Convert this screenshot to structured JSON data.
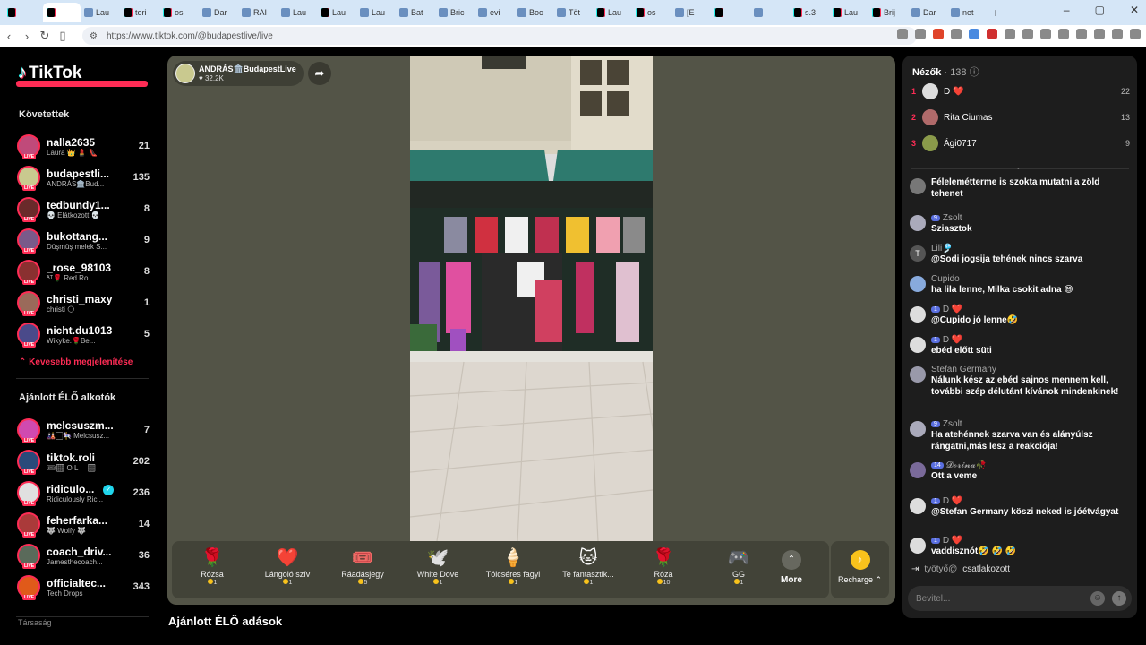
{
  "browser": {
    "tabs": [
      {
        "label": "",
        "icon": "tiktok"
      },
      {
        "label": "",
        "icon": "tiktok"
      },
      {
        "label": "Lau",
        "icon": "doc"
      },
      {
        "label": "tori",
        "icon": "tiktok"
      },
      {
        "label": "os",
        "icon": "tiktok"
      },
      {
        "label": "Dar",
        "icon": "doc"
      },
      {
        "label": "RAI",
        "icon": "doc"
      },
      {
        "label": "Lau",
        "icon": "doc"
      },
      {
        "label": "Lau",
        "icon": "tiktok"
      },
      {
        "label": "Lau",
        "icon": "doc"
      },
      {
        "label": "Bat",
        "icon": "doc"
      },
      {
        "label": "Bric",
        "icon": "doc"
      },
      {
        "label": "evi",
        "icon": "doc"
      },
      {
        "label": "Boc",
        "icon": "doc"
      },
      {
        "label": "Töt",
        "icon": "doc"
      },
      {
        "label": "Lau",
        "icon": "tiktok"
      },
      {
        "label": "os",
        "icon": "tiktok"
      },
      {
        "label": "[E",
        "icon": "doc"
      },
      {
        "label": "",
        "icon": "tiktok"
      },
      {
        "label": "",
        "icon": "doc"
      },
      {
        "label": "s.3",
        "icon": "tiktok"
      },
      {
        "label": "Lau",
        "icon": "tiktok"
      },
      {
        "label": "Brij",
        "icon": "tiktok"
      },
      {
        "label": "Dar",
        "icon": "doc"
      },
      {
        "label": "net",
        "icon": "doc"
      }
    ],
    "url": "https://www.tiktok.com/@budapestlive/live"
  },
  "sidebar": {
    "brand": "TikTok",
    "following_title": "Követettek",
    "following": [
      {
        "name": "nalla2635",
        "sub": "Laura 👑 💄 👠",
        "count": "21",
        "color": "#c04a7a"
      },
      {
        "name": "budapestli...",
        "sub": "ANDRÁS🏛️Bud...",
        "count": "135",
        "color": "#c9c98f"
      },
      {
        "name": "tedbundy1...",
        "sub": "💀 Elátkozott 💀",
        "count": "8",
        "color": "#6a2a2a"
      },
      {
        "name": "bukottang...",
        "sub": "Düşmüş melek S...",
        "count": "9",
        "color": "#7a5a8a"
      },
      {
        "name": "_rose_98103",
        "sub": "ᴬᵀ🌹 Red Ro...",
        "count": "8",
        "color": "#8a3030"
      },
      {
        "name": "christi_maxy",
        "sub": "christi 🌕",
        "count": "1",
        "color": "#9a6a5a"
      },
      {
        "name": "nicht.du1013",
        "sub": "Wikyke.🌹Be...",
        "count": "5",
        "color": "#4a4a8a"
      }
    ],
    "show_less": "Kevesebb megjelenítése",
    "recommended_title": "Ajánlott ÉLŐ alkotók",
    "recommended": [
      {
        "name": "melcsuszm...",
        "sub": "🎎🏻🎠 Melcsusz...",
        "count": "7",
        "color": "#d04ab0"
      },
      {
        "name": "tiktok.roli",
        "sub": "🎟🏻 O L 🏻",
        "count": "202",
        "color": "#2a4a7a"
      },
      {
        "name": "ridiculo...",
        "sub": "Ridiculously Ric...",
        "count": "236",
        "color": "#e0e0e0",
        "verified": true
      },
      {
        "name": "feherfarka...",
        "sub": "🐺 Wolfy 🐺",
        "count": "14",
        "color": "#aa3a3a"
      },
      {
        "name": "coach_driv...",
        "sub": "Jamesthecoach...",
        "count": "36",
        "color": "#5a6a5a"
      },
      {
        "name": "officialtec...",
        "sub": "Tech Drops",
        "count": "343",
        "color": "#e05a1a"
      }
    ],
    "bottom_cut": "Társaság"
  },
  "live": {
    "host_name": "ANDRÁS🏛️BudapestLive",
    "host_likes": "32.2K",
    "gifts": [
      {
        "icon": "🌹",
        "name": "Rózsa",
        "cost": "1"
      },
      {
        "icon": "❤️",
        "name": "Lángoló szív",
        "cost": "1"
      },
      {
        "icon": "🎟️",
        "name": "Ráadásjegy",
        "cost": "5"
      },
      {
        "icon": "🕊️",
        "name": "White Dove",
        "cost": "1"
      },
      {
        "icon": "🍦",
        "name": "Tölcséres fagyi",
        "cost": "1"
      },
      {
        "icon": "🐱",
        "name": "Te fantasztik...",
        "cost": "1"
      },
      {
        "icon": "🌹",
        "name": "Róza",
        "cost": "10"
      },
      {
        "icon": "🎮",
        "name": "GG",
        "cost": "1"
      }
    ],
    "more_label": "More",
    "recharge_label": "Recharge ⌃",
    "recommended_title": "Ajánlott ÉLŐ adások"
  },
  "chat": {
    "viewers_title": "Nézők",
    "viewers_count": "· 138",
    "top_viewers": [
      {
        "rank": "1",
        "name": "D ❤️",
        "score": "22",
        "color": "#ddd"
      },
      {
        "rank": "2",
        "name": "Rita Ciumas",
        "score": "13",
        "color": "#b06a6a"
      },
      {
        "rank": "3",
        "name": "Ági0717",
        "score": "9",
        "color": "#8a9a4a"
      }
    ],
    "messages": [
      {
        "user": "",
        "badge": "",
        "text": "Félelemétterme is szokta mutatni a zöld tehenet",
        "color": "#777"
      },
      {
        "user": "Zsolt",
        "badge": "9",
        "text": "Sziasztok",
        "color": "#aab"
      },
      {
        "user": "Lili🎐",
        "badge": "",
        "text": "@Sodi jogsija tehének nincs szarva",
        "color": "#555",
        "letter": "T"
      },
      {
        "user": "Cupido",
        "badge": "",
        "text": "ha lila lenne, Milka csokit adna 😄",
        "color": "#8ad"
      },
      {
        "user": "D ❤️",
        "badge": "1",
        "text": "@Cupido jó lenne🤣",
        "color": "#ddd"
      },
      {
        "user": "D ❤️",
        "badge": "1",
        "text": "ebéd előtt süti",
        "color": "#ddd"
      },
      {
        "user": "Stefan Germany",
        "badge": "",
        "text": "Nálunk kész az ebéd sajnos mennem kell, további szép délutánt kívánok mindenkinek!",
        "color": "#99a"
      },
      {
        "user": "Zsolt",
        "badge": "9",
        "text": "Ha atehénnek szarva van és alányúlsz rángatni,más lesz a reakciója!",
        "color": "#aab"
      },
      {
        "user": "𝓓𝓸𝓻𝓲𝓷𝓪🥀",
        "badge": "14",
        "text": "Ott a veme",
        "color": "#7a6a9a"
      },
      {
        "user": "D ❤️",
        "badge": "1",
        "text": "@Stefan Germany köszi neked is jóétvágyat",
        "color": "#ddd"
      },
      {
        "user": "D ❤️",
        "badge": "1",
        "text": "vaddisznót🤣 🤣 🤣",
        "color": "#ddd"
      }
    ],
    "joined_user": "työtyő@",
    "joined_text": "csatlakozott",
    "input_placeholder": "Bevitel..."
  }
}
